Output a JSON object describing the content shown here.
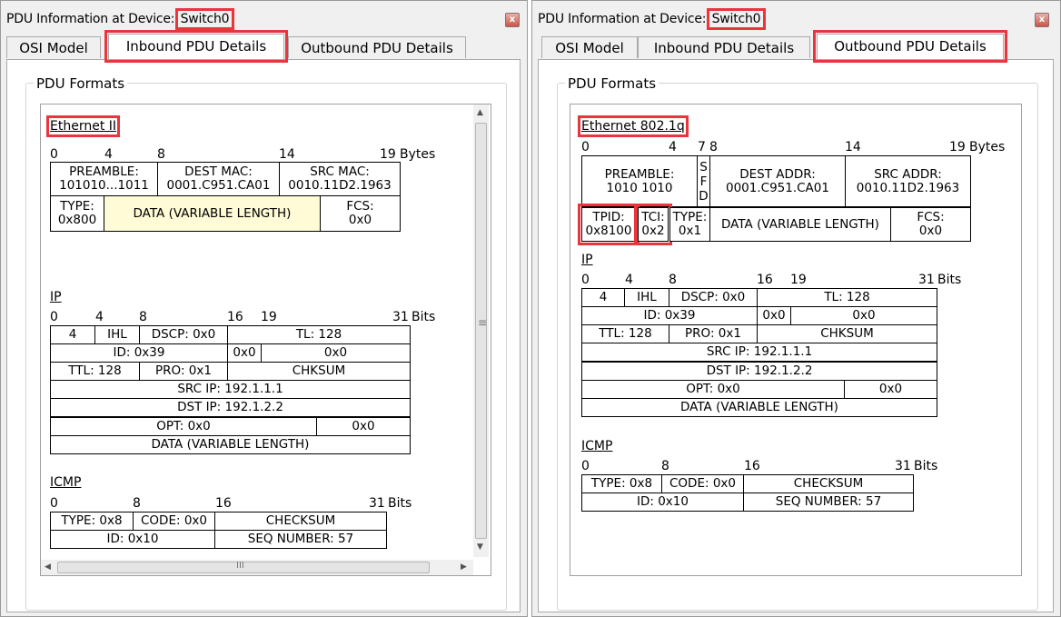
{
  "left": {
    "title": "PDU Information at Device:",
    "device": "Switch0",
    "close": "x",
    "tabs": [
      "OSI Model",
      "Inbound PDU Details",
      "Outbound PDU Details"
    ],
    "group_label": "PDU Formats",
    "eth": {
      "title": "Ethernet II",
      "nums": [
        "0",
        "4",
        "8",
        "14",
        "19"
      ],
      "unit": "Bytes",
      "row1": [
        "PREAMBLE:",
        "101010...1011",
        "DEST MAC:",
        "0001.C951.CA01",
        "SRC MAC:",
        "0010.11D2.1963"
      ],
      "row2": [
        "TYPE:",
        "0x800",
        "DATA (VARIABLE LENGTH)",
        "FCS:",
        "0x0"
      ]
    },
    "ip": {
      "title": "IP",
      "nums": [
        "0",
        "4",
        "8",
        "16",
        "19",
        "31"
      ],
      "unit": "Bits",
      "cells": [
        "4",
        "IHL",
        "DSCP: 0x0",
        "TL: 128",
        "ID: 0x39",
        "0x0",
        "0x0",
        "TTL: 128",
        "PRO: 0x1",
        "CHKSUM",
        "SRC IP: 192.1.1.1",
        "DST IP: 192.1.2.2",
        "OPT: 0x0",
        "0x0",
        "DATA (VARIABLE LENGTH)"
      ]
    },
    "icmp": {
      "title": "ICMP",
      "nums": [
        "0",
        "8",
        "16",
        "31"
      ],
      "unit": "Bits",
      "cells": [
        "TYPE: 0x8",
        "CODE: 0x0",
        "CHECKSUM",
        "ID: 0x10",
        "SEQ NUMBER: 57"
      ]
    },
    "scroll_grip": "≡",
    "hscroll_grip": "III"
  },
  "right": {
    "title": "PDU Information at Device:",
    "device": "Switch0",
    "close": "x",
    "tabs": [
      "OSI Model",
      "Inbound PDU Details",
      "Outbound PDU Details"
    ],
    "group_label": "PDU Formats",
    "eth": {
      "title": "Ethernet 802.1q",
      "nums": [
        "0",
        "4",
        "7",
        "8",
        "14",
        "19"
      ],
      "unit": "Bytes",
      "row1": [
        "PREAMBLE:",
        "1010 1010",
        "S",
        "F",
        "D",
        "DEST ADDR:",
        "0001.C951.CA01",
        "SRC ADDR:",
        "0010.11D2.1963"
      ],
      "row2": [
        "TPID:",
        "0x8100",
        "TCI:",
        "0x2",
        "TYPE:",
        "0x1",
        "DATA (VARIABLE LENGTH)",
        "FCS:",
        "0x0"
      ]
    },
    "ip": {
      "title": "IP",
      "nums": [
        "0",
        "4",
        "8",
        "16",
        "19",
        "31"
      ],
      "unit": "Bits",
      "cells": [
        "4",
        "IHL",
        "DSCP: 0x0",
        "TL: 128",
        "ID: 0x39",
        "0x0",
        "0x0",
        "TTL: 128",
        "PRO: 0x1",
        "CHKSUM",
        "SRC IP: 192.1.1.1",
        "DST IP: 192.1.2.2",
        "OPT: 0x0",
        "0x0",
        "DATA (VARIABLE LENGTH)"
      ]
    },
    "icmp": {
      "title": "ICMP",
      "nums": [
        "0",
        "8",
        "16",
        "31"
      ],
      "unit": "Bits",
      "cells": [
        "TYPE: 0x8",
        "CODE: 0x0",
        "CHECKSUM",
        "ID: 0x10",
        "SEQ NUMBER: 57"
      ]
    }
  },
  "colors": {
    "highlight": "#e8363c",
    "data_fill": "#fffbd6"
  }
}
